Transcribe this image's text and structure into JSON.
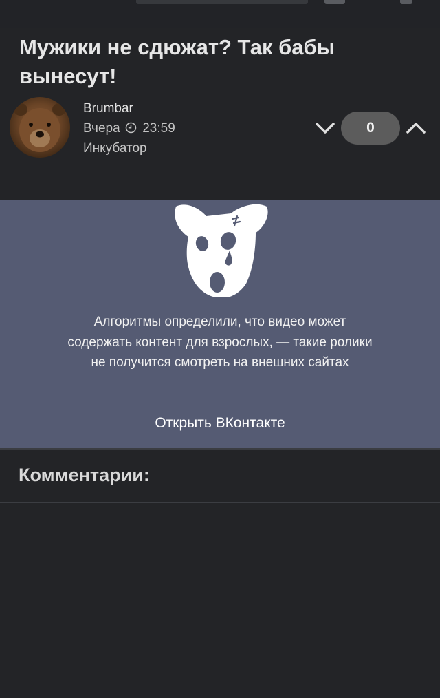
{
  "post": {
    "title": "Мужики не сдюжат?  Так бабы вынесут!",
    "author": "Brumbar",
    "date": "Вчера",
    "time": "23:59",
    "community": "Инкубатор",
    "rating": "0",
    "avatar_icon": "bear-avatar",
    "clock_icon": "clock-icon"
  },
  "video": {
    "message": "Алгоритмы определили, что видео может содержать контент для взрослых, — такие ролики не получится смотреть на внешних сайтах",
    "open_label": "Открыть ВКонтакте",
    "logo_icon": "vk-sad-dog-logo",
    "background_color": "#555b73"
  },
  "comments": {
    "title": "Комментарии:"
  },
  "colors": {
    "background": "#232427",
    "rating_pill": "#5c5c5c",
    "text": "#e6e6e6"
  }
}
